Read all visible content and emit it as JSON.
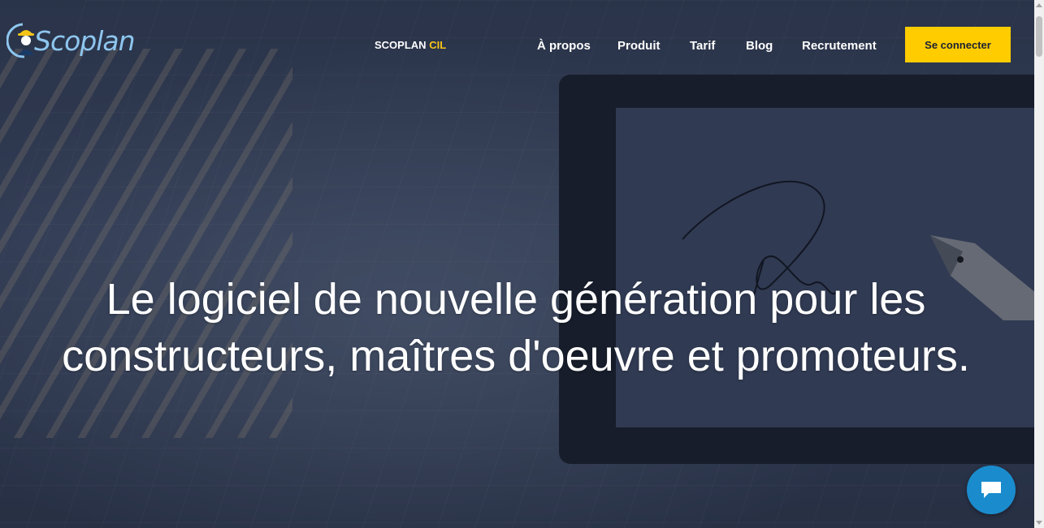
{
  "brand": {
    "name": "Scoplan",
    "logo_icon": "worker-helmet-icon"
  },
  "product_link": {
    "prefix": "SCOPLAN",
    "suffix": "CIL"
  },
  "nav": {
    "items": [
      {
        "label": "À propos"
      },
      {
        "label": "Produit"
      },
      {
        "label": "Tarif"
      },
      {
        "label": "Blog"
      },
      {
        "label": "Recrutement"
      }
    ],
    "login_label": "Se connecter"
  },
  "hero": {
    "headline_line1": "Le logiciel de nouvelle génération pour les",
    "headline_line2": "constructeurs, maîtres d'oeuvre et promoteurs."
  },
  "chat": {
    "icon": "chat-bubble-icon"
  },
  "colors": {
    "accent": "#ffcc00",
    "brand": "#8ec6ef",
    "chat": "#1a8ccd"
  }
}
